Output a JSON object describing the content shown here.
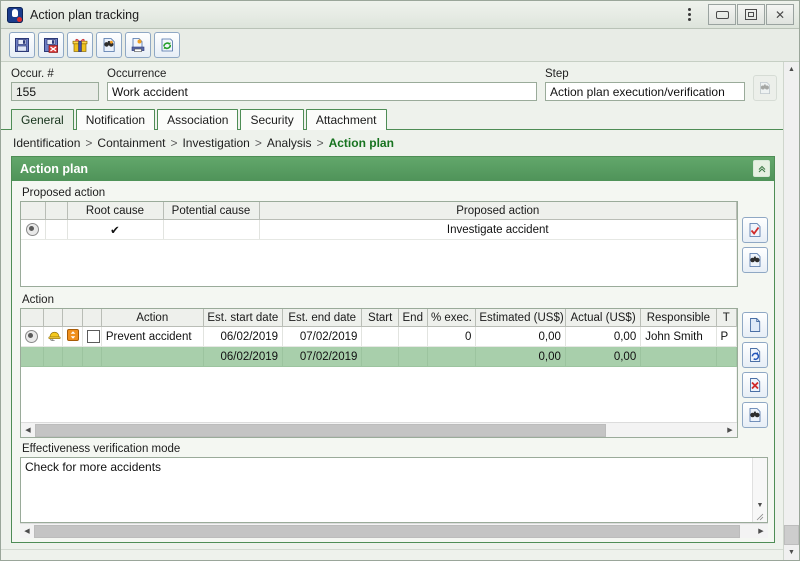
{
  "window": {
    "title": "Action plan tracking",
    "app_icon": "app-icon",
    "controls": {
      "menu": "window-menu-dots",
      "minimize": "minimize",
      "maximize": "maximize",
      "close": "close"
    }
  },
  "toolbar": {
    "buttons": [
      {
        "name": "save-button",
        "icon": "save-icon",
        "tooltip": "Save"
      },
      {
        "name": "save-and-exit-button",
        "icon": "save-delete-icon",
        "tooltip": "Save and exit"
      },
      {
        "name": "package-button",
        "icon": "gift-package-icon",
        "tooltip": "Package"
      },
      {
        "name": "search-button",
        "icon": "binoculars-document-icon",
        "tooltip": "Search"
      },
      {
        "name": "report-button",
        "icon": "print-report-icon",
        "tooltip": "Report"
      },
      {
        "name": "refresh-button",
        "icon": "refresh-icon",
        "tooltip": "Refresh"
      }
    ]
  },
  "fields": {
    "occurrence_number": {
      "label": "Occur. #",
      "value": "155"
    },
    "occurrence": {
      "label": "Occurrence",
      "value": "Work accident"
    },
    "step": {
      "label": "Step",
      "value": "Action plan execution/verification"
    },
    "step_find_icon": "binoculars-icon"
  },
  "tabs": [
    {
      "label": "General",
      "active": true
    },
    {
      "label": "Notification",
      "active": false
    },
    {
      "label": "Association",
      "active": false
    },
    {
      "label": "Security",
      "active": false
    },
    {
      "label": "Attachment",
      "active": false
    }
  ],
  "breadcrumb": {
    "items": [
      "Identification",
      "Containment",
      "Investigation",
      "Analysis"
    ],
    "separator": ">",
    "current": "Action plan"
  },
  "panel": {
    "title": "Action plan",
    "collapse_icon": "collapse-icon"
  },
  "proposed_action": {
    "group_label": "Proposed action",
    "columns": [
      "",
      "",
      "Root cause",
      "Potential cause",
      "Proposed action"
    ],
    "rows": [
      {
        "selected": true,
        "root_cause": "✔",
        "potential_cause": "",
        "proposed_action": "Investigate accident"
      }
    ],
    "buttons": [
      {
        "name": "proposed-action-select-button",
        "icon": "check-document-icon"
      },
      {
        "name": "proposed-action-search-button",
        "icon": "binoculars-document-icon"
      }
    ]
  },
  "action": {
    "group_label": "Action",
    "columns": [
      "",
      "",
      "",
      "",
      "Action",
      "Est. start date",
      "Est. end date",
      "Start",
      "End",
      "% exec.",
      "Estimated (US$)",
      "Actual (US$)",
      "Responsible",
      "T"
    ],
    "rows": [
      {
        "selected": true,
        "icon_worker": "hard-hat-icon",
        "icon_priority": "orange-updown-icon",
        "checkbox": false,
        "action": "Prevent accident",
        "est_start_date": "06/02/2019",
        "est_end_date": "07/02/2019",
        "start": "",
        "end": "",
        "pct_exec": "0",
        "estimated": "0,00",
        "actual": "0,00",
        "responsible": "John Smith",
        "type": "P"
      }
    ],
    "summary_row": {
      "est_start_date": "06/02/2019",
      "est_end_date": "07/02/2019",
      "estimated": "0,00",
      "actual": "0,00"
    },
    "buttons": [
      {
        "name": "action-new-button",
        "icon": "new-document-icon"
      },
      {
        "name": "action-refresh-button",
        "icon": "refresh-document-icon"
      },
      {
        "name": "action-delete-button",
        "icon": "delete-document-icon"
      },
      {
        "name": "action-search-button",
        "icon": "binoculars-document-icon"
      }
    ]
  },
  "effectiveness": {
    "label": "Effectiveness verification mode",
    "value": "Check for more accidents"
  },
  "colors": {
    "accent_green": "#4e8d55",
    "panel_header": "#5aa063",
    "summary_row": "#a8cfab",
    "window_bg": "#eef2ec",
    "breadcrumb_current": "#17731f"
  }
}
